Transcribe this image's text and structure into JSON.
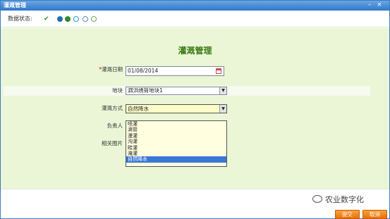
{
  "window": {
    "title": "灌溉管理",
    "minimize_icon": "minimize-icon",
    "close_icon": "close-icon"
  },
  "status": {
    "label": "数据状态:",
    "icons": [
      "check-icon",
      "approve-icon",
      "verify-icon",
      "refresh-icon",
      "info-icon"
    ],
    "colors": {
      "check": "#2f8a2f",
      "approve": "#1f6fb5",
      "verify": "#3a8fd0",
      "refresh": "#5a8fbf",
      "info": "#6ab04c"
    }
  },
  "form": {
    "heading": "灌溉管理",
    "date_label_req": "*",
    "date_label": "灌溉日期",
    "date_value": "01/08/2014",
    "plot_label": "地块",
    "plot_value": "泗洪绣荷地块1",
    "method_label": "灌溉方式",
    "method_value": "自然降水",
    "person_label": "负责人",
    "photo_label": "相关图片"
  },
  "dropdown": {
    "options": [
      "喷灌",
      "滴管",
      "漫灌",
      "沟灌",
      "畦灌",
      "淹灌",
      "自然降水"
    ],
    "selected_index": 6
  },
  "footer": {
    "submit_label": "提交",
    "cancel_label": "取消",
    "watermark": "农业数字化"
  },
  "colors": {
    "accent": "#3a7a12",
    "panel_bg": "#eaf6d6",
    "button": "#f08a1c",
    "titlebar": "#2f78c9"
  }
}
